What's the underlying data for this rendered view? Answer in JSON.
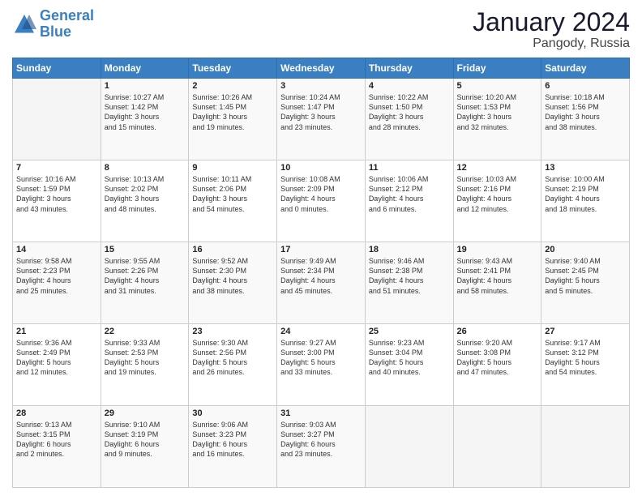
{
  "logo": {
    "line1": "General",
    "line2": "Blue"
  },
  "title": "January 2024",
  "subtitle": "Pangody, Russia",
  "weekdays": [
    "Sunday",
    "Monday",
    "Tuesday",
    "Wednesday",
    "Thursday",
    "Friday",
    "Saturday"
  ],
  "weeks": [
    [
      {
        "day": "",
        "info": ""
      },
      {
        "day": "1",
        "info": "Sunrise: 10:27 AM\nSunset: 1:42 PM\nDaylight: 3 hours\nand 15 minutes."
      },
      {
        "day": "2",
        "info": "Sunrise: 10:26 AM\nSunset: 1:45 PM\nDaylight: 3 hours\nand 19 minutes."
      },
      {
        "day": "3",
        "info": "Sunrise: 10:24 AM\nSunset: 1:47 PM\nDaylight: 3 hours\nand 23 minutes."
      },
      {
        "day": "4",
        "info": "Sunrise: 10:22 AM\nSunset: 1:50 PM\nDaylight: 3 hours\nand 28 minutes."
      },
      {
        "day": "5",
        "info": "Sunrise: 10:20 AM\nSunset: 1:53 PM\nDaylight: 3 hours\nand 32 minutes."
      },
      {
        "day": "6",
        "info": "Sunrise: 10:18 AM\nSunset: 1:56 PM\nDaylight: 3 hours\nand 38 minutes."
      }
    ],
    [
      {
        "day": "7",
        "info": "Sunrise: 10:16 AM\nSunset: 1:59 PM\nDaylight: 3 hours\nand 43 minutes."
      },
      {
        "day": "8",
        "info": "Sunrise: 10:13 AM\nSunset: 2:02 PM\nDaylight: 3 hours\nand 48 minutes."
      },
      {
        "day": "9",
        "info": "Sunrise: 10:11 AM\nSunset: 2:06 PM\nDaylight: 3 hours\nand 54 minutes."
      },
      {
        "day": "10",
        "info": "Sunrise: 10:08 AM\nSunset: 2:09 PM\nDaylight: 4 hours\nand 0 minutes."
      },
      {
        "day": "11",
        "info": "Sunrise: 10:06 AM\nSunset: 2:12 PM\nDaylight: 4 hours\nand 6 minutes."
      },
      {
        "day": "12",
        "info": "Sunrise: 10:03 AM\nSunset: 2:16 PM\nDaylight: 4 hours\nand 12 minutes."
      },
      {
        "day": "13",
        "info": "Sunrise: 10:00 AM\nSunset: 2:19 PM\nDaylight: 4 hours\nand 18 minutes."
      }
    ],
    [
      {
        "day": "14",
        "info": "Sunrise: 9:58 AM\nSunset: 2:23 PM\nDaylight: 4 hours\nand 25 minutes."
      },
      {
        "day": "15",
        "info": "Sunrise: 9:55 AM\nSunset: 2:26 PM\nDaylight: 4 hours\nand 31 minutes."
      },
      {
        "day": "16",
        "info": "Sunrise: 9:52 AM\nSunset: 2:30 PM\nDaylight: 4 hours\nand 38 minutes."
      },
      {
        "day": "17",
        "info": "Sunrise: 9:49 AM\nSunset: 2:34 PM\nDaylight: 4 hours\nand 45 minutes."
      },
      {
        "day": "18",
        "info": "Sunrise: 9:46 AM\nSunset: 2:38 PM\nDaylight: 4 hours\nand 51 minutes."
      },
      {
        "day": "19",
        "info": "Sunrise: 9:43 AM\nSunset: 2:41 PM\nDaylight: 4 hours\nand 58 minutes."
      },
      {
        "day": "20",
        "info": "Sunrise: 9:40 AM\nSunset: 2:45 PM\nDaylight: 5 hours\nand 5 minutes."
      }
    ],
    [
      {
        "day": "21",
        "info": "Sunrise: 9:36 AM\nSunset: 2:49 PM\nDaylight: 5 hours\nand 12 minutes."
      },
      {
        "day": "22",
        "info": "Sunrise: 9:33 AM\nSunset: 2:53 PM\nDaylight: 5 hours\nand 19 minutes."
      },
      {
        "day": "23",
        "info": "Sunrise: 9:30 AM\nSunset: 2:56 PM\nDaylight: 5 hours\nand 26 minutes."
      },
      {
        "day": "24",
        "info": "Sunrise: 9:27 AM\nSunset: 3:00 PM\nDaylight: 5 hours\nand 33 minutes."
      },
      {
        "day": "25",
        "info": "Sunrise: 9:23 AM\nSunset: 3:04 PM\nDaylight: 5 hours\nand 40 minutes."
      },
      {
        "day": "26",
        "info": "Sunrise: 9:20 AM\nSunset: 3:08 PM\nDaylight: 5 hours\nand 47 minutes."
      },
      {
        "day": "27",
        "info": "Sunrise: 9:17 AM\nSunset: 3:12 PM\nDaylight: 5 hours\nand 54 minutes."
      }
    ],
    [
      {
        "day": "28",
        "info": "Sunrise: 9:13 AM\nSunset: 3:15 PM\nDaylight: 6 hours\nand 2 minutes."
      },
      {
        "day": "29",
        "info": "Sunrise: 9:10 AM\nSunset: 3:19 PM\nDaylight: 6 hours\nand 9 minutes."
      },
      {
        "day": "30",
        "info": "Sunrise: 9:06 AM\nSunset: 3:23 PM\nDaylight: 6 hours\nand 16 minutes."
      },
      {
        "day": "31",
        "info": "Sunrise: 9:03 AM\nSunset: 3:27 PM\nDaylight: 6 hours\nand 23 minutes."
      },
      {
        "day": "",
        "info": ""
      },
      {
        "day": "",
        "info": ""
      },
      {
        "day": "",
        "info": ""
      }
    ]
  ]
}
